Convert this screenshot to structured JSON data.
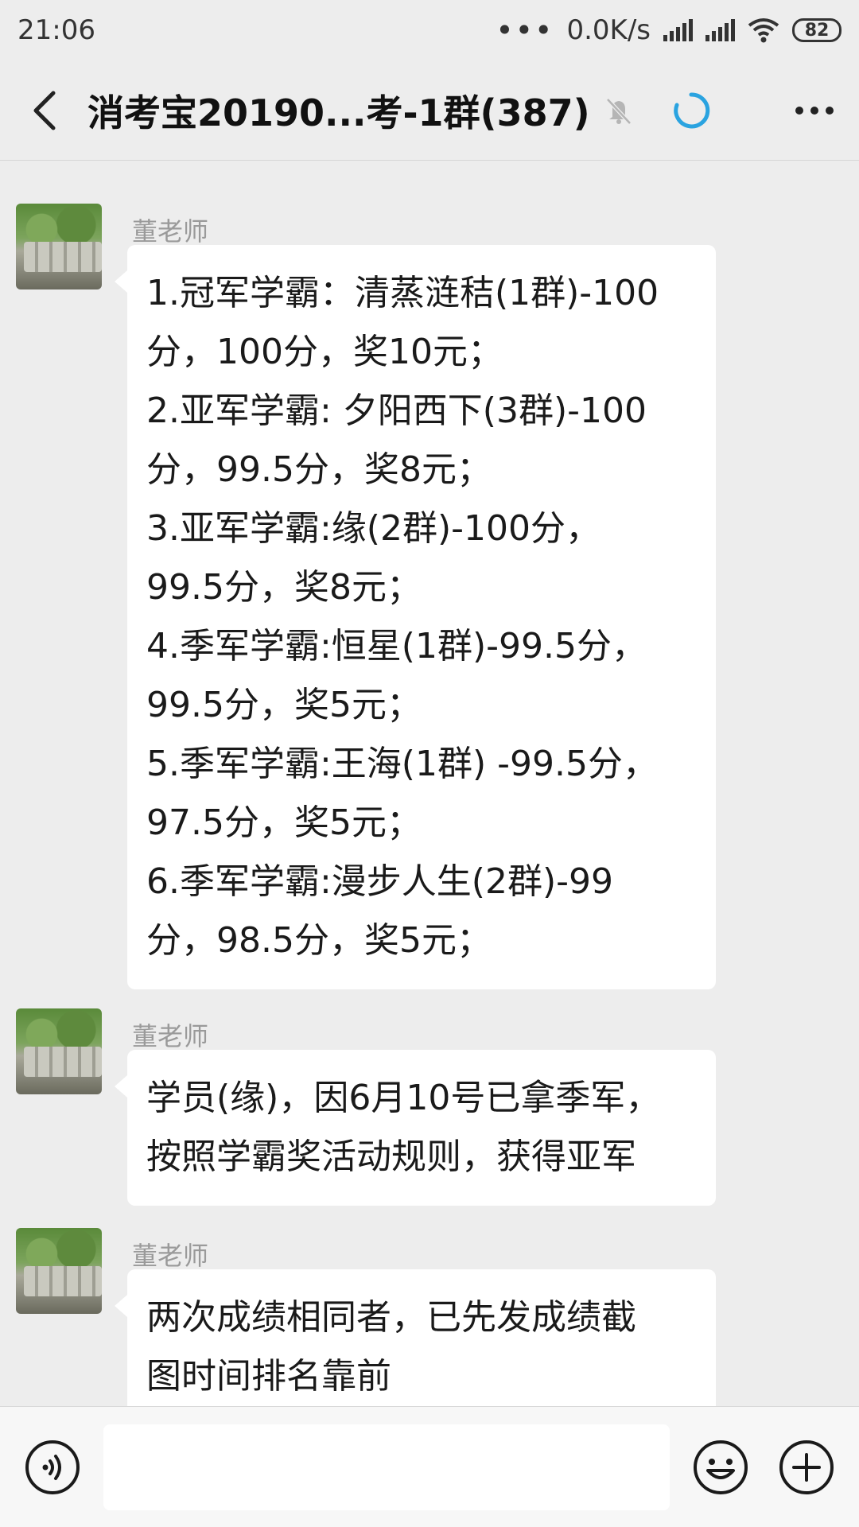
{
  "status_bar": {
    "time": "21:06",
    "more": "•••",
    "network_speed": "0.0K/s",
    "battery": "82"
  },
  "header": {
    "title": "消考宝20190...考-1群(387)"
  },
  "messages": [
    {
      "sender": "董老师",
      "lines": [
        "1.冠军学霸：清蒸涟秸(1群)-100",
        "分，100分，奖10元；",
        "2.亚军学霸: 夕阳西下(3群)-100",
        "分，99.5分，奖8元；",
        "3.亚军学霸:缘(2群)-100分，",
        "99.5分，奖8元；",
        "4.季军学霸:恒星(1群)-99.5分，",
        "99.5分，奖5元；",
        "5.季军学霸:王海(1群) -99.5分，",
        "97.5分，奖5元；",
        "6.季军学霸:漫步人生(2群)-99",
        "分，98.5分，奖5元；"
      ]
    },
    {
      "sender": "",
      "lines": [
        "学员(缘)，因6月10号已拿季军，",
        "按照学霸奖活动规则，获得亚军"
      ]
    },
    {
      "sender": "董老师",
      "lines": [
        "两次成绩相同者，已先发成绩截",
        "图时间排名靠前"
      ]
    }
  ],
  "input_bar": {
    "placeholder": ""
  },
  "icons": {
    "back": "chevron-left-icon",
    "mute": "bell-off-icon",
    "loading": "loading-spinner-icon",
    "more": "more-horizontal-icon",
    "voice": "voice-icon",
    "emoji": "emoji-icon",
    "plus": "plus-icon"
  },
  "colors": {
    "background": "#ededed",
    "bubble": "#ffffff",
    "accent": "#2aa3e0"
  }
}
